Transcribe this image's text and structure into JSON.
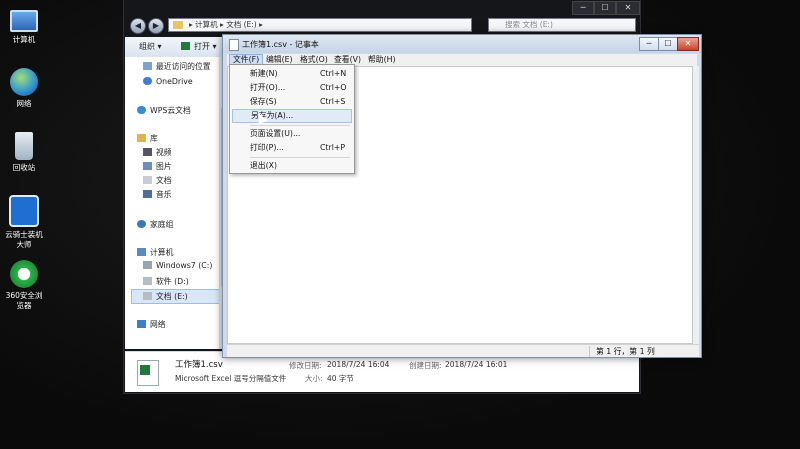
{
  "desktop": {
    "icons": [
      {
        "label": "计算机"
      },
      {
        "label": "网络"
      },
      {
        "label": "回收站"
      },
      {
        "label": "云骑士装机大师"
      },
      {
        "label": "360安全浏览器"
      }
    ]
  },
  "explorer": {
    "breadcrumb": [
      "计算机",
      "文档 (E:)"
    ],
    "search_placeholder": "搜索 文档 (E:)",
    "toolbar": {
      "organize": "组织 ▾",
      "open": "打开 ▾"
    },
    "nav": {
      "recent": "最近访问的位置",
      "onedrive": "OneDrive",
      "wps": "WPS云文档",
      "library": "库",
      "video": "视频",
      "pictures": "图片",
      "documents": "文档",
      "music": "音乐",
      "homegroup": "家庭组",
      "computer": "计算机",
      "drive_c": "Windows7 (C:)",
      "drive_d": "软件 (D:)",
      "drive_e": "文档 (E:)",
      "network": "网络"
    },
    "details": {
      "filename": "工作簿1.csv",
      "filetype": "Microsoft Excel 逗号分隔值文件",
      "modified_label": "修改日期:",
      "modified_value": "2018/7/24 16:04",
      "created_label": "创建日期:",
      "created_value": "2018/7/24 16:01",
      "size_label": "大小:",
      "size_value": "40 字节"
    }
  },
  "notepad": {
    "title": "工作簿1.csv - 记事本",
    "menu": {
      "file": "文件(F)",
      "edit": "编辑(E)",
      "format": "格式(O)",
      "view": "查看(V)",
      "help": "帮助(H)"
    },
    "status": "第 1 行，第 1 列",
    "file_menu": {
      "new": {
        "label": "新建(N)",
        "shortcut": "Ctrl+N"
      },
      "open": {
        "label": "打开(O)...",
        "shortcut": "Ctrl+O"
      },
      "save": {
        "label": "保存(S)",
        "shortcut": "Ctrl+S"
      },
      "save_as": {
        "label": "另存为(A)..."
      },
      "page_setup": {
        "label": "页面设置(U)..."
      },
      "print": {
        "label": "打印(P)...",
        "shortcut": "Ctrl+P"
      },
      "exit": {
        "label": "退出(X)"
      }
    }
  }
}
